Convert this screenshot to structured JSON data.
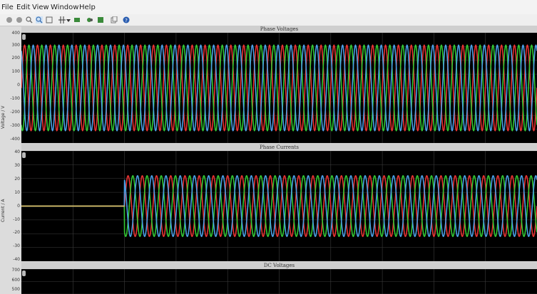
{
  "menu": [
    "File",
    "Edit",
    "View",
    "Window",
    "Help"
  ],
  "toolbar_icons": [
    "stop-icon",
    "pause-icon",
    "zoom-icon",
    "zoom-selected-icon",
    "fit-icon",
    "cursor-icon",
    "dropdown-icon",
    "record-icon",
    "link-icon",
    "save-icon",
    "copy-icon",
    "help-icon"
  ],
  "colors": {
    "phase_a": "#e83232",
    "phase_b": "#32c832",
    "phase_c": "#4aa0e6",
    "background": "#000000",
    "grid": "#3c3c3c",
    "title_bar": "#cfcfcf"
  },
  "panels": [
    {
      "title": "Phase Voltages",
      "ylabel": "Voltage / V",
      "yticks": [
        "400",
        "300",
        "200",
        "100",
        "0",
        "-100",
        "-200",
        "-300",
        "-400"
      ]
    },
    {
      "title": "Phase Currents",
      "ylabel": "Current / A",
      "yticks": [
        "40",
        "30",
        "20",
        "10",
        "0",
        "-10",
        "-20",
        "-30",
        "-40"
      ]
    },
    {
      "title": "DC Voltages",
      "ylabel": "",
      "yticks": [
        "700",
        "600",
        "500"
      ]
    }
  ],
  "chart_data": [
    {
      "type": "line",
      "title": "Phase Voltages",
      "ylabel": "Voltage / V",
      "ylim": [
        -400,
        400
      ],
      "grid": true,
      "series": [
        {
          "color": "#e83232",
          "waveform": "sine",
          "amplitude": 310,
          "phase_deg": 0,
          "cycles_visible": 40
        },
        {
          "color": "#32c832",
          "waveform": "sine",
          "amplitude": 310,
          "phase_deg": -120,
          "cycles_visible": 40
        },
        {
          "color": "#4aa0e6",
          "waveform": "sine",
          "amplitude": 310,
          "phase_deg": 120,
          "cycles_visible": 40
        }
      ]
    },
    {
      "type": "line",
      "title": "Phase Currents",
      "ylabel": "Current / A",
      "ylim": [
        -40,
        40
      ],
      "grid": true,
      "series": [
        {
          "color": "#e83232",
          "waveform": "sine",
          "amplitude": 22,
          "phase_deg": 0,
          "start_fraction": 0.2,
          "cycles_visible": 29,
          "pre_start_value": 0
        },
        {
          "color": "#32c832",
          "waveform": "sine",
          "amplitude": 22,
          "phase_deg": -120,
          "start_fraction": 0.2,
          "cycles_visible": 29,
          "pre_start_value": 0
        },
        {
          "color": "#4aa0e6",
          "waveform": "sine",
          "amplitude": 22,
          "phase_deg": 120,
          "start_fraction": 0.2,
          "cycles_visible": 29,
          "pre_start_value": 0
        }
      ]
    },
    {
      "type": "line",
      "title": "DC Voltages",
      "ylabel": "",
      "ylim": [
        480,
        700
      ],
      "grid": true,
      "series": []
    }
  ]
}
